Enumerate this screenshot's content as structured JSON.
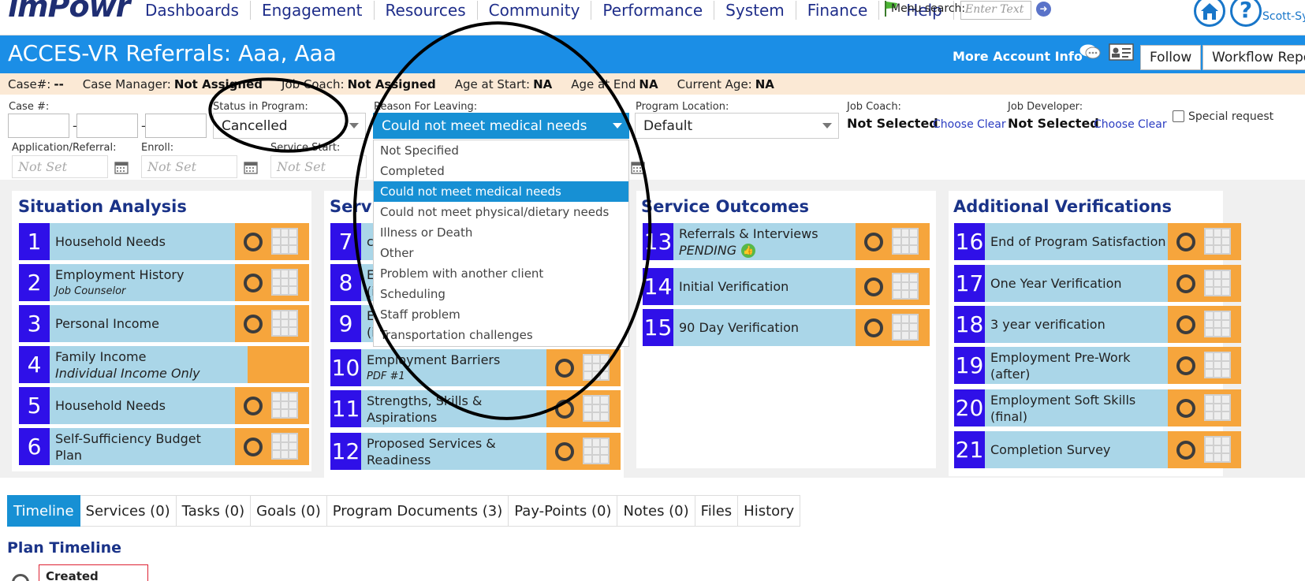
{
  "nav": {
    "logo": "imPowr",
    "items": [
      "Dashboards",
      "Engagement",
      "Resources",
      "Community",
      "Performance",
      "System",
      "Finance"
    ],
    "help": "Help",
    "menu_search_label": "Menu search:",
    "menu_search_placeholder": "Enter Text",
    "user": "Scott-Sy"
  },
  "header": {
    "title": "ACCES-VR Referrals: Aaa, Aaa",
    "more_info": "More Account Info",
    "follow": "Follow",
    "workflow": "Workflow Repo"
  },
  "casebar": {
    "case_label": "Case#:",
    "case_val": "--",
    "cm_label": "Case Manager:",
    "cm_val": "Not Assigned",
    "jc_label": "Job Coach:",
    "jc_val": "Not Assigned",
    "ages_label": "Age at Start:",
    "ages_val": "NA",
    "agee_label": "Age at End",
    "agee_val": "NA",
    "agec_label": "Current Age:",
    "agec_val": "NA"
  },
  "form": {
    "case_no_label": "Case #:",
    "status_label": "Status in Program:",
    "status_value": "Cancelled",
    "reason_label": "Reason For Leaving:",
    "reason_value": "Could not meet medical needs",
    "location_label": "Program Location:",
    "location_value": "Default",
    "job_coach_label": "Job Coach:",
    "job_coach_value": "Not Selected",
    "job_dev_label": "Job Developer:",
    "job_dev_value": "Not Selected",
    "choose": "Choose",
    "clear": "Clear",
    "special_request": "Special request",
    "app_label": "Application/Referral:",
    "enroll_label": "Enroll:",
    "service_start_label": "Service Start:",
    "not_set": "Not Set"
  },
  "dropdown": {
    "options": [
      "Not Specified",
      "Completed",
      "Could not meet medical needs",
      "Could not meet physical/dietary needs",
      "Illness or Death",
      "Other",
      "Problem with another client",
      "Scheduling",
      "Staff problem",
      "Transportation challenges"
    ],
    "selected_index": 2
  },
  "panels": {
    "situation": {
      "title": "Situation Analysis",
      "tasks": [
        {
          "num": "1",
          "label": "Household Needs",
          "sub": ""
        },
        {
          "num": "2",
          "label": "Employment History",
          "sub": "Job Counselor"
        },
        {
          "num": "3",
          "label": "Personal Income",
          "sub": ""
        },
        {
          "num": "4",
          "label": "Family Income",
          "sub": "Individual Income Only"
        },
        {
          "num": "5",
          "label": "Household Needs",
          "sub": ""
        },
        {
          "num": "6",
          "label": "Self-Sufficiency Budget",
          "sub": "Plan"
        }
      ]
    },
    "services": {
      "title": "Servic",
      "tasks": [
        {
          "num": "7",
          "label": "c",
          "sub": ""
        },
        {
          "num": "8",
          "label": "E",
          "sub": "(i"
        },
        {
          "num": "9",
          "label": "E",
          "sub": "(i"
        },
        {
          "num": "10",
          "label": "Employment Barriers",
          "sub": "PDF #1"
        },
        {
          "num": "11",
          "label": "Strengths, Skills &",
          "sub": "Aspirations"
        },
        {
          "num": "12",
          "label": "Proposed Services &",
          "sub": "Readiness"
        }
      ]
    },
    "outcomes": {
      "title": "Service Outcomes",
      "tasks": [
        {
          "num": "13",
          "label": "Referrals & Interviews",
          "sub": "PENDING"
        },
        {
          "num": "14",
          "label": "Initial Verification",
          "sub": ""
        },
        {
          "num": "15",
          "label": "90 Day Verification",
          "sub": ""
        }
      ]
    },
    "verifications": {
      "title": "Additional Verifications",
      "tasks": [
        {
          "num": "16",
          "label": "End of Program Satisfaction",
          "sub": ""
        },
        {
          "num": "17",
          "label": "One Year Verification",
          "sub": ""
        },
        {
          "num": "18",
          "label": "3 year verification",
          "sub": ""
        },
        {
          "num": "19",
          "label": "Employment Pre-Work",
          "sub": "(after)"
        },
        {
          "num": "20",
          "label": "Employment Soft Skills",
          "sub": "(final)"
        },
        {
          "num": "21",
          "label": "Completion Survey",
          "sub": ""
        }
      ]
    }
  },
  "tabs": [
    "Timeline",
    "Services (0)",
    "Tasks (0)",
    "Goals (0)",
    "Program Documents (3)",
    "Pay-Points (0)",
    "Notes (0)",
    "Files",
    "History"
  ],
  "timeline": {
    "title": "Plan Timeline",
    "created": "Created"
  },
  "colors": {
    "header_blue": "#1b8ee6",
    "task_number": "#2f10e8",
    "task_body": "#aad6e8",
    "task_action": "#f6a53c",
    "title_navy": "#1a3388"
  }
}
